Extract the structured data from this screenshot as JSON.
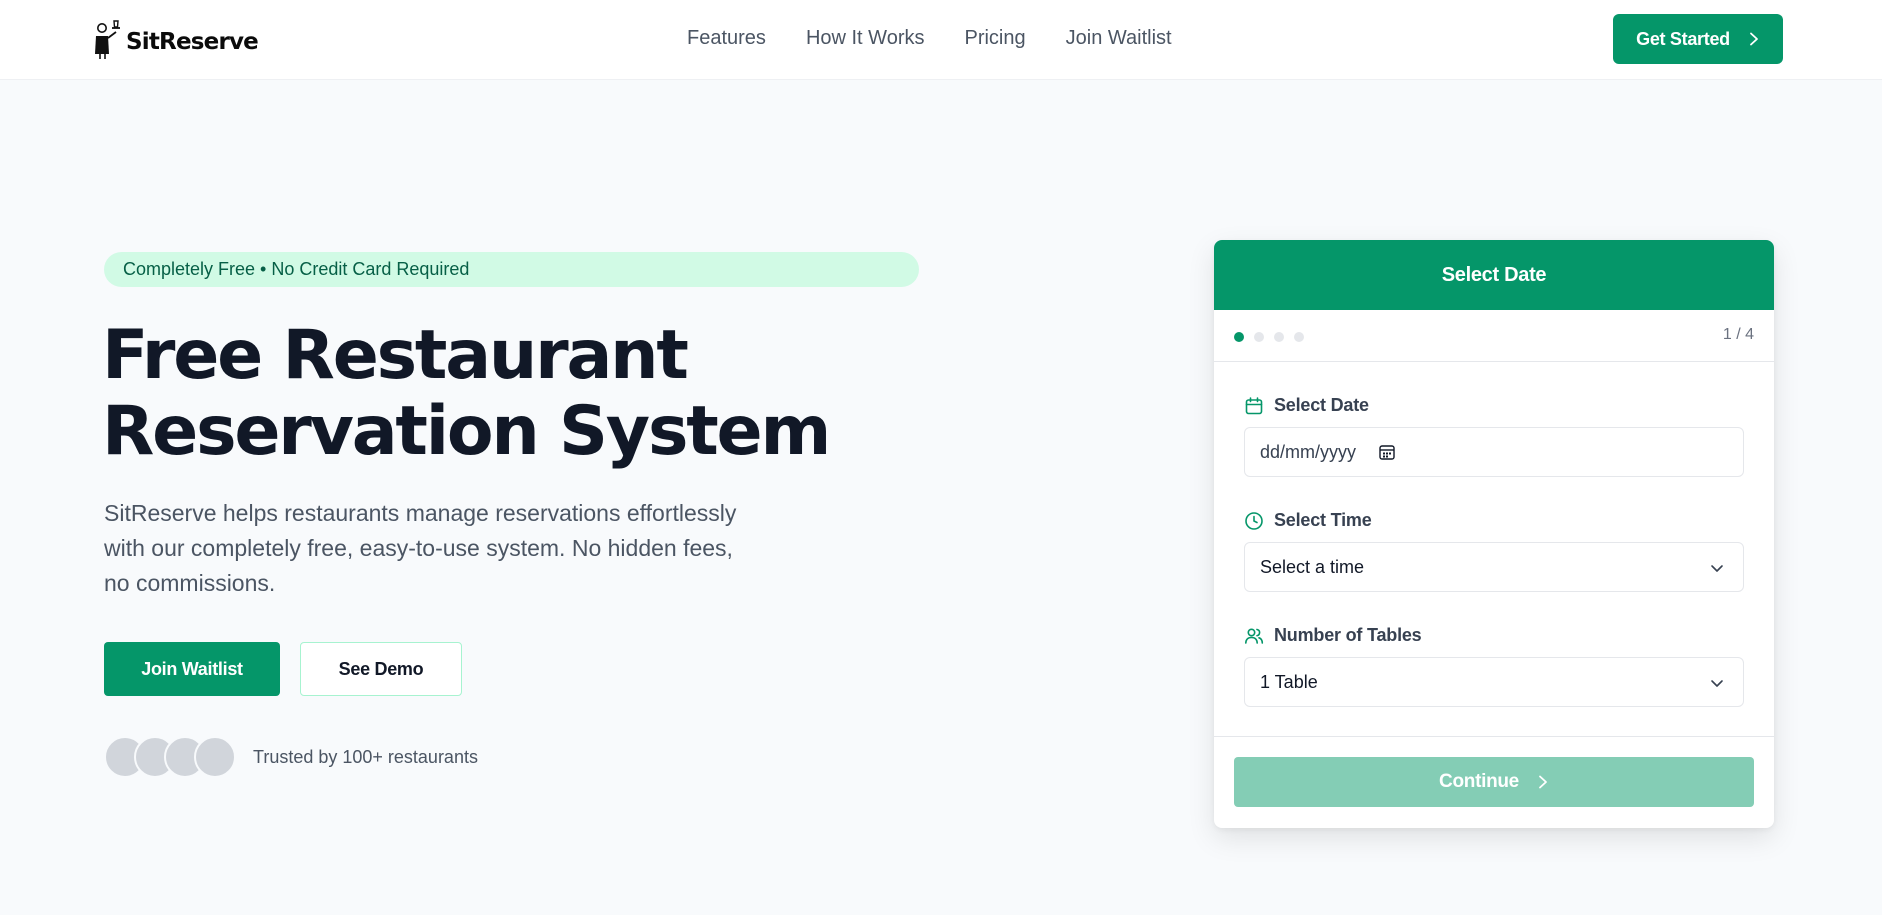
{
  "nav": {
    "brand": "SitReserve",
    "links": [
      "Features",
      "How It Works",
      "Pricing",
      "Join Waitlist"
    ],
    "cta_label": "Get Started"
  },
  "hero": {
    "badge": "Completely Free • No Credit Card Required",
    "title_line1": "Free Restaurant",
    "title_line2": "Reservation System",
    "description": "SitReserve helps restaurants manage reservations effortlessly with our completely free, easy-to-use system. No hidden fees, no commissions.",
    "primary_button": "Join Waitlist",
    "secondary_button": "See Demo",
    "trusted_text": "Trusted by 100+ restaurants"
  },
  "booking": {
    "header": "Select Date",
    "step_indicator": "1 / 4",
    "current_step": 1,
    "total_steps": 4,
    "date_label": "Select Date",
    "date_placeholder": "dd/mm/yyyy",
    "time_label": "Select Time",
    "time_value": "Select a time",
    "tables_label": "Number of Tables",
    "tables_value": "1 Table",
    "continue_label": "Continue"
  },
  "colors": {
    "accent": "#059669",
    "accent_light": "#d1fae5",
    "continue_disabled": "#84cdb5"
  }
}
